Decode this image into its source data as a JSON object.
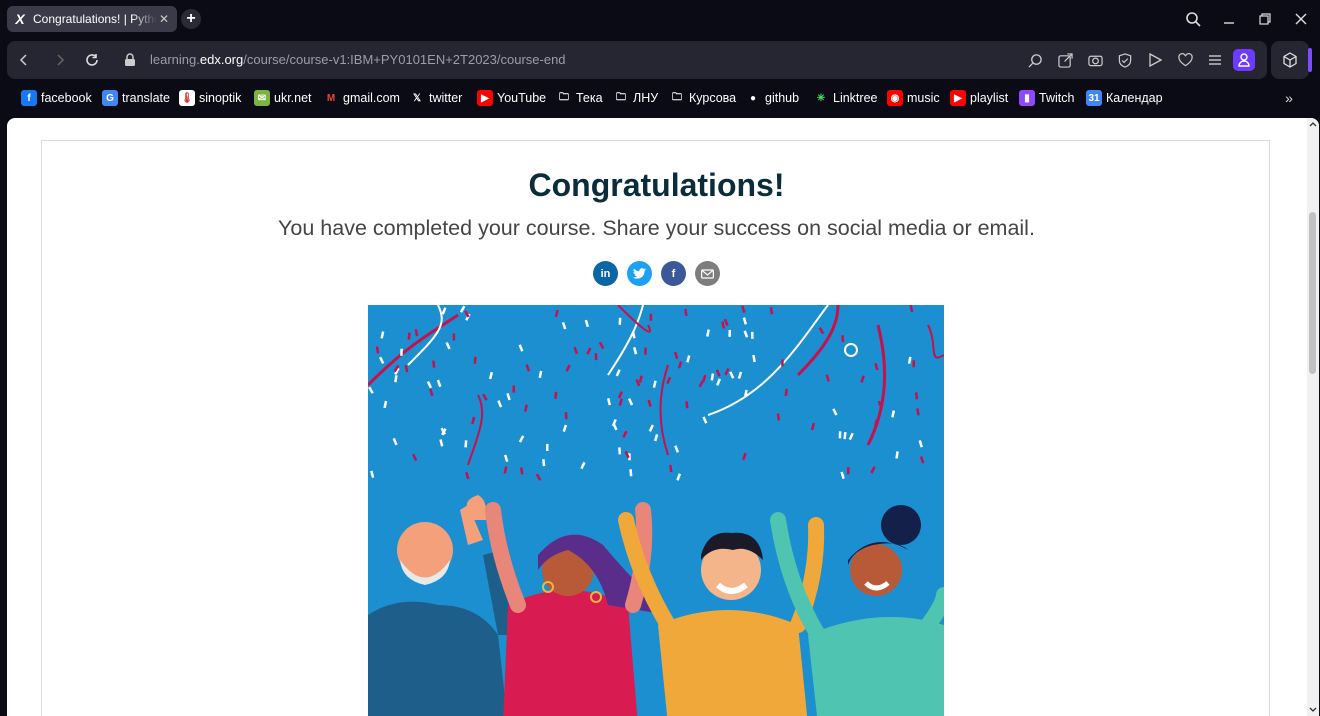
{
  "browser": {
    "tab_title": "Congratulations! | Python",
    "tab_favicon": "X",
    "new_tab_symbol": "+",
    "url_prefix": "learning.",
    "url_host": "edx.org",
    "url_path": "/course/course-v1:IBM+PY0101EN+2T2023/course-end",
    "accent_color": "#6c3bff"
  },
  "bookmarks": [
    {
      "label": "facebook",
      "icon": "facebook-icon"
    },
    {
      "label": "translate",
      "icon": "google-translate-icon"
    },
    {
      "label": "sinoptik",
      "icon": "thermometer-icon"
    },
    {
      "label": "ukr.net",
      "icon": "ukrnet-icon"
    },
    {
      "label": "gmail.com",
      "icon": "gmail-icon"
    },
    {
      "label": "twitter",
      "icon": "x-icon"
    },
    {
      "label": "YouTube",
      "icon": "youtube-icon"
    },
    {
      "label": "Тека",
      "icon": "folder-icon"
    },
    {
      "label": "ЛНУ",
      "icon": "folder-icon"
    },
    {
      "label": "Курсова",
      "icon": "folder-icon"
    },
    {
      "label": "github",
      "icon": "github-icon"
    },
    {
      "label": "Linktree",
      "icon": "linktree-icon"
    },
    {
      "label": "music",
      "icon": "music-icon"
    },
    {
      "label": "playlist",
      "icon": "youtube-icon"
    },
    {
      "label": "Twitch",
      "icon": "twitch-icon"
    },
    {
      "label": "Календар",
      "icon": "calendar-icon"
    }
  ],
  "page": {
    "heading": "Congratulations!",
    "subheading": "You have completed your course. Share your success on social media or email.",
    "share_buttons": [
      {
        "name": "linkedin",
        "glyph": "in",
        "color": "#0a66a5"
      },
      {
        "name": "twitter",
        "glyph": "t",
        "color": "#1da1f2"
      },
      {
        "name": "facebook",
        "glyph": "f",
        "color": "#3b5998"
      },
      {
        "name": "email",
        "glyph": "✉",
        "color": "#7d7d7d"
      }
    ],
    "hero_background": "#1b8fd0"
  }
}
